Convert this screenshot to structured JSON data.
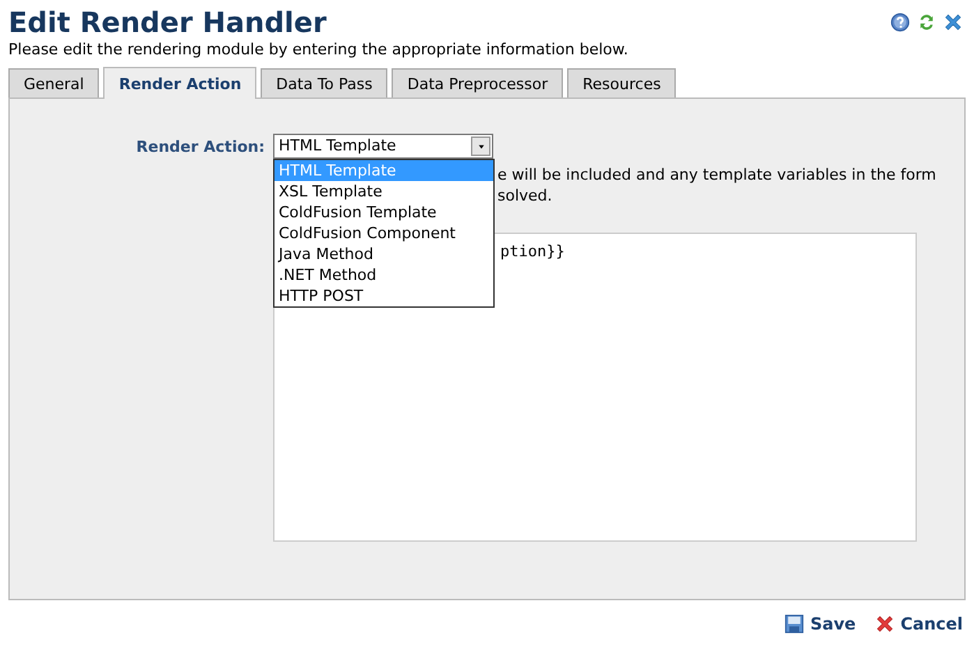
{
  "header": {
    "title": "Edit Render Handler",
    "subtitle": "Please edit the rendering module by entering the appropriate information below."
  },
  "tabs": [
    {
      "label": "General",
      "selected": false
    },
    {
      "label": "Render Action",
      "selected": true
    },
    {
      "label": "Data To Pass",
      "selected": false
    },
    {
      "label": "Data Preprocessor",
      "selected": false
    },
    {
      "label": "Resources",
      "selected": false
    }
  ],
  "form": {
    "label": "Render Action:",
    "select": {
      "value": "HTML Template",
      "expanded": true,
      "options": [
        {
          "label": "HTML Template",
          "selected": true
        },
        {
          "label": "XSL Template",
          "selected": false
        },
        {
          "label": "ColdFusion Template",
          "selected": false
        },
        {
          "label": "ColdFusion Component",
          "selected": false
        },
        {
          "label": "Java Method",
          "selected": false
        },
        {
          "label": ".NET Method",
          "selected": false
        },
        {
          "label": "HTTP POST",
          "selected": false
        }
      ]
    },
    "help_text_lines": [
      "e will be included and any template variables in the form",
      "solved."
    ],
    "textarea": {
      "value": "ption}}"
    }
  },
  "buttons": [
    {
      "label": "Save",
      "kind": "save"
    },
    {
      "label": "Cancel",
      "kind": "cancel"
    }
  ]
}
